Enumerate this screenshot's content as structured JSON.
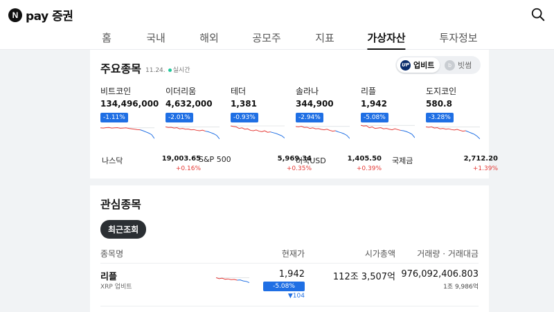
{
  "header": {
    "logo_letter": "N",
    "logo_text": "pay 증권",
    "search_icon": "search-icon"
  },
  "nav": [
    {
      "label": "홈",
      "active": false
    },
    {
      "label": "국내",
      "active": false
    },
    {
      "label": "해외",
      "active": false
    },
    {
      "label": "공모주",
      "active": false
    },
    {
      "label": "지표",
      "active": false
    },
    {
      "label": "가상자산",
      "active": true
    },
    {
      "label": "투자정보",
      "active": false
    }
  ],
  "major": {
    "title": "주요종목",
    "date": "11.24.",
    "live": "실시간",
    "toggle": {
      "upbit": {
        "label": "업비트",
        "icon": "upbit-logo-icon",
        "badge": "UP"
      },
      "bithumb": {
        "label": "빗썸",
        "icon": "bithumb-logo-icon",
        "badge": "b"
      }
    },
    "coins": [
      {
        "name": "비트코인",
        "price": "134,496,000",
        "change": "-1.11%",
        "spark": [
          0.35,
          0.36,
          0.34,
          0.33,
          0.36,
          0.35,
          0.34,
          0.37,
          0.36,
          0.35,
          0.38,
          0.4,
          0.42,
          0.44,
          0.45,
          0.5,
          0.56,
          0.62,
          0.7,
          0.9
        ]
      },
      {
        "name": "이더리움",
        "price": "4,632,000",
        "change": "-2.01%",
        "spark": [
          0.3,
          0.33,
          0.32,
          0.36,
          0.34,
          0.4,
          0.38,
          0.42,
          0.41,
          0.45,
          0.44,
          0.48,
          0.5,
          0.47,
          0.52,
          0.55,
          0.6,
          0.66,
          0.74,
          0.92
        ]
      },
      {
        "name": "테더",
        "price": "1,381",
        "change": "-0.93%",
        "spark": [
          0.25,
          0.28,
          0.3,
          0.38,
          0.35,
          0.42,
          0.4,
          0.48,
          0.5,
          0.46,
          0.52,
          0.55,
          0.5,
          0.58,
          0.56,
          0.6,
          0.64,
          0.7,
          0.76,
          0.88
        ]
      },
      {
        "name": "솔라나",
        "price": "344,900",
        "change": "-2.94%",
        "spark": [
          0.28,
          0.3,
          0.27,
          0.33,
          0.32,
          0.38,
          0.35,
          0.4,
          0.39,
          0.43,
          0.45,
          0.42,
          0.48,
          0.52,
          0.5,
          0.56,
          0.6,
          0.66,
          0.74,
          0.9
        ]
      },
      {
        "name": "리플",
        "price": "1,942",
        "change": "-5.08%",
        "spark": [
          0.22,
          0.26,
          0.24,
          0.34,
          0.3,
          0.38,
          0.36,
          0.34,
          0.4,
          0.38,
          0.42,
          0.45,
          0.4,
          0.44,
          0.48,
          0.5,
          0.54,
          0.6,
          0.68,
          0.86
        ]
      },
      {
        "name": "도지코인",
        "price": "580.8",
        "change": "-3.28%",
        "spark": [
          0.3,
          0.32,
          0.3,
          0.36,
          0.34,
          0.4,
          0.38,
          0.42,
          0.4,
          0.44,
          0.46,
          0.43,
          0.48,
          0.52,
          0.5,
          0.56,
          0.62,
          0.68,
          0.78,
          0.92
        ]
      }
    ],
    "indices": [
      {
        "name": "나스닥",
        "value": "19,003.65",
        "change": "+0.16%"
      },
      {
        "name": "S&P 500",
        "value": "5,969.34",
        "change": "+0.35%"
      },
      {
        "name": "미국USD",
        "value": "1,405.50",
        "change": "+0.39%"
      },
      {
        "name": "국제금",
        "value": "2,712.20",
        "change": "+1.39%"
      }
    ]
  },
  "watch": {
    "title": "관심종목",
    "pill": "최근조회",
    "columns": {
      "name": "종목명",
      "price": "현재가",
      "cap": "시가총액",
      "volume": "거래량 · 거래대금"
    },
    "row": {
      "name": "리플",
      "sub": "XRP 업비트",
      "price": "1,942",
      "change": "-5.08%",
      "diff": "▼104",
      "cap": "112조 3,507억",
      "volume": "976,092,406.803",
      "amount": "1조 9,986억",
      "spark": [
        0.3,
        0.38,
        0.34,
        0.42,
        0.4,
        0.46,
        0.44,
        0.5,
        0.48,
        0.56,
        0.6,
        0.7
      ]
    }
  },
  "colors": {
    "down": "#1f6fe4",
    "up": "#e53935",
    "spark_red": "#e53935",
    "spark_blue": "#1f6fe4"
  }
}
